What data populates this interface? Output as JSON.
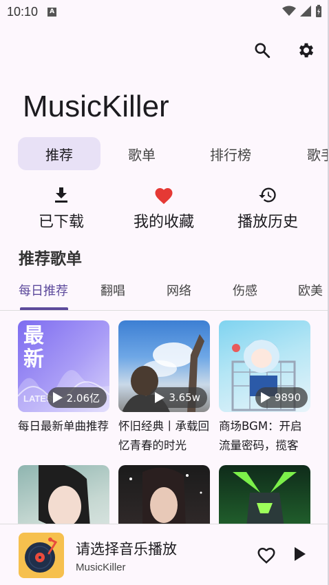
{
  "status": {
    "time": "10:10",
    "notif_letter": "A"
  },
  "header": {
    "app_title": "MusicKiller"
  },
  "tabs": [
    {
      "label": "推荐"
    },
    {
      "label": "歌单"
    },
    {
      "label": "排行榜"
    },
    {
      "label": "歌手"
    }
  ],
  "quick_actions": [
    {
      "label": "已下载",
      "icon": "download-icon"
    },
    {
      "label": "我的收藏",
      "icon": "heart-icon"
    },
    {
      "label": "播放历史",
      "icon": "history-icon"
    }
  ],
  "section": {
    "title": "推荐歌单"
  },
  "categories": [
    {
      "label": "每日推荐"
    },
    {
      "label": "翻唱"
    },
    {
      "label": "网络"
    },
    {
      "label": "伤感"
    },
    {
      "label": "欧美"
    }
  ],
  "playlists": [
    {
      "title": "每日最新单曲推荐",
      "plays": "2.06亿",
      "cover_text": "最\n新",
      "cover_sub": "LATEST"
    },
    {
      "title": "怀旧经典丨承载回忆青春的时光",
      "plays": "3.65w"
    },
    {
      "title": "商场BGM：开启流量密码，揽客",
      "plays": "9890"
    },
    {
      "title": "",
      "plays": ""
    },
    {
      "title": "",
      "plays": ""
    },
    {
      "title": "",
      "plays": ""
    }
  ],
  "player": {
    "title": "请选择音乐播放",
    "subtitle": "MusicKiller"
  },
  "colors": {
    "accent": "#5d4a9c",
    "heart": "#e53935",
    "tab_active_bg": "#e8e1f6"
  }
}
